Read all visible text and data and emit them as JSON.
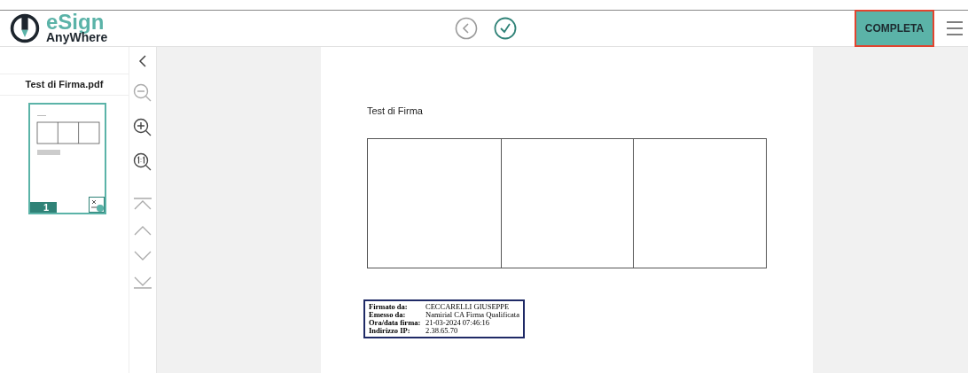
{
  "logo": {
    "title": "eSign",
    "subtitle": "AnyWhere"
  },
  "toolbar": {
    "complete_button": "COMPLETA",
    "complete_highlighted": true
  },
  "sidebar": {
    "file_name": "Test di Firma.pdf",
    "thumbnails": [
      {
        "page": "1",
        "selected": true
      }
    ]
  },
  "document": {
    "heading": "Test di Firma",
    "signature": [
      {
        "label": "Firmato da:",
        "value": "CECCARELLI GIUSEPPE"
      },
      {
        "label": "Emesso da:",
        "value": "Namirial CA Firma Qualificata"
      },
      {
        "label": "Ora/data firma:",
        "value": "21-03-2024 07:46:16"
      },
      {
        "label": "Indirizzo IP:",
        "value": "2.38.65.70"
      }
    ]
  }
}
